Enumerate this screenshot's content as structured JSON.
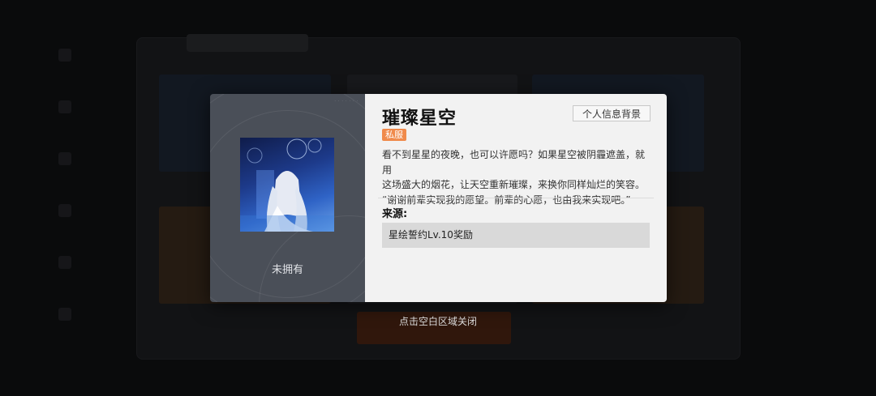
{
  "dialog": {
    "title": "璀璨星空",
    "type_button": "个人信息背景",
    "tag": "私服",
    "description_lines": [
      "看不到星星的夜晚，也可以许愿吗？如果星空被阴霾遮盖，就用",
      "这场盛大的烟花，让天空重新璀璨，来换你同样灿烂的笑容。",
      "“谢谢前辈实现我的愿望。前辈的心愿，也由我来实现吧。”"
    ],
    "source_title": "来源:",
    "source_item": "星绘誓约Lv.10奖励",
    "owned_status": "未拥有",
    "portrait_icon": "character-portrait",
    "tag_color": "#f08a4b"
  },
  "close_hint": "点击空白区域关闭"
}
